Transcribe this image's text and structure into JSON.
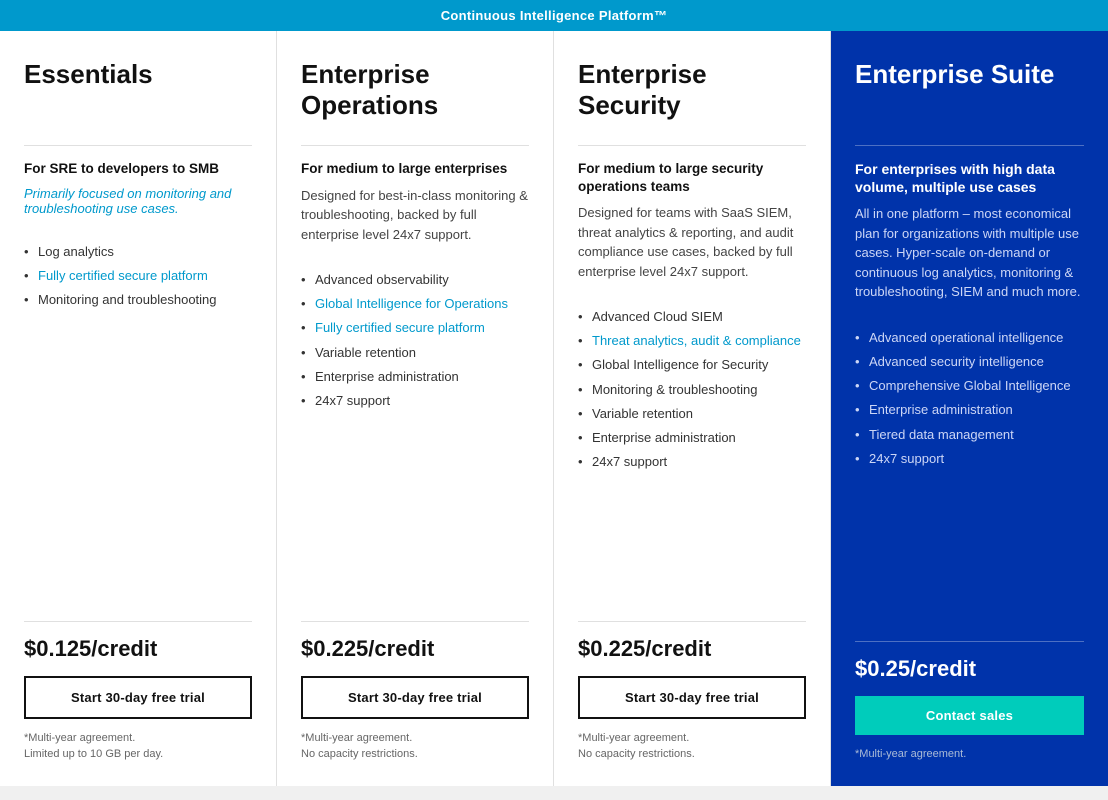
{
  "topBar": {
    "label": "Continuous Intelligence Platform™"
  },
  "plans": [
    {
      "id": "essentials",
      "title": "Essentials",
      "targetAudience": "For SRE to developers to SMB",
      "targetDesc": "Primarily focused on monitoring and troubleshooting use cases.",
      "targetDescIsHighlight": true,
      "features": [
        {
          "text": "Log analytics",
          "isLink": false
        },
        {
          "text": "Fully certified secure platform",
          "isLink": true
        },
        {
          "text": "Monitoring and troubleshooting",
          "isLink": false
        }
      ],
      "price": "$0.125/credit",
      "priceAsterisk": true,
      "ctaLabel": "Start 30-day free trial",
      "ctaType": "trial",
      "footnote": "*Multi-year agreement.\nLimited up to 10 GB per day."
    },
    {
      "id": "enterprise-operations",
      "title": "Enterprise Operations",
      "targetAudience": "For medium to large enterprises",
      "targetDesc": "Designed for best-in-class monitoring & troubleshooting, backed by full enterprise level 24x7 support.",
      "targetDescIsHighlight": false,
      "features": [
        {
          "text": "Advanced observability",
          "isLink": false
        },
        {
          "text": "Global Intelligence for Operations",
          "isLink": true
        },
        {
          "text": "Fully certified secure platform",
          "isLink": true
        },
        {
          "text": "Variable retention",
          "isLink": false
        },
        {
          "text": "Enterprise administration",
          "isLink": false
        },
        {
          "text": "24x7 support",
          "isLink": false
        }
      ],
      "price": "$0.225/credit",
      "priceAsterisk": true,
      "ctaLabel": "Start 30-day free trial",
      "ctaType": "trial",
      "footnote": "*Multi-year agreement.\nNo capacity restrictions."
    },
    {
      "id": "enterprise-security",
      "title": "Enterprise Security",
      "targetAudience": "For medium to large security operations teams",
      "targetDesc": "Designed for teams with SaaS SIEM, threat analytics & reporting, and audit compliance use cases, backed by full enterprise level 24x7 support.",
      "targetDescIsHighlight": false,
      "features": [
        {
          "text": "Advanced Cloud SIEM",
          "isLink": false
        },
        {
          "text": "Threat analytics, audit & compliance",
          "isLink": true
        },
        {
          "text": "Global Intelligence for Security",
          "isLink": false
        },
        {
          "text": "Monitoring & troubleshooting",
          "isLink": false
        },
        {
          "text": "Variable retention",
          "isLink": false
        },
        {
          "text": "Enterprise administration",
          "isLink": false
        },
        {
          "text": "24x7 support",
          "isLink": false
        }
      ],
      "price": "$0.225/credit",
      "priceAsterisk": true,
      "ctaLabel": "Start 30-day free trial",
      "ctaType": "trial",
      "footnote": "*Multi-year agreement.\nNo capacity restrictions."
    },
    {
      "id": "enterprise-suite",
      "title": "Enterprise Suite",
      "targetAudience": "For enterprises with high data volume, multiple use cases",
      "targetDesc": "All in one platform – most economical plan for organizations with multiple use cases. Hyper-scale on-demand or continuous log analytics, monitoring & troubleshooting, SIEM and much more.",
      "targetDescIsHighlight": false,
      "features": [
        {
          "text": "Advanced operational intelligence",
          "isLink": false
        },
        {
          "text": "Advanced security intelligence",
          "isLink": false
        },
        {
          "text": "Comprehensive Global Intelligence",
          "isLink": false
        },
        {
          "text": "Enterprise administration",
          "isLink": false
        },
        {
          "text": "Tiered data management",
          "isLink": false
        },
        {
          "text": "24x7 support",
          "isLink": false
        }
      ],
      "price": "$0.25/credit",
      "priceAsterisk": true,
      "ctaLabel": "Contact sales",
      "ctaType": "contact",
      "footnote": "*Multi-year agreement."
    }
  ]
}
